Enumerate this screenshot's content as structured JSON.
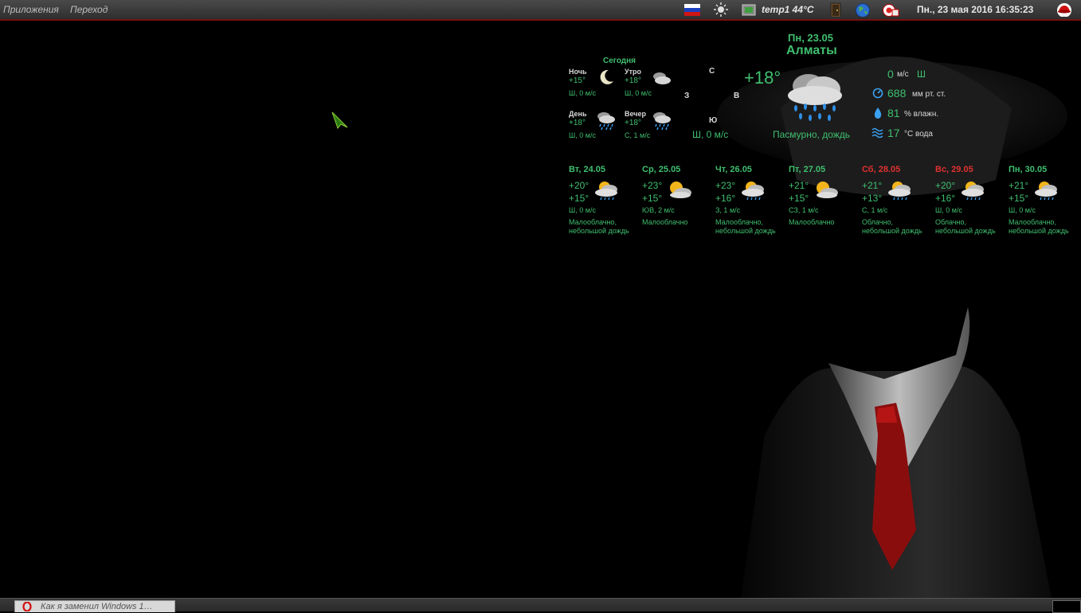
{
  "panel": {
    "menu_apps": "Приложения",
    "menu_go": "Переход",
    "sensor": "temp1 44°C",
    "datetime": "Пн., 23 мая 2016 16:35:23"
  },
  "current": {
    "date": "Пн, 23.05",
    "city": "Алматы",
    "temp": "+18°",
    "condition": "Пасмурно, дождь",
    "compass": {
      "n": "С",
      "w": "З",
      "e": "В",
      "s": "Ю"
    },
    "wind": "Ш, 0 м/с",
    "wind_speed": "0",
    "wind_unit": "м/с",
    "wind_dir": "Ш",
    "pressure": "688",
    "pressure_unit": "мм рт. ст.",
    "humidity": "81",
    "humidity_unit": "% влажн.",
    "water": "17",
    "water_unit": "°С вода"
  },
  "today": {
    "label": "Сегодня",
    "parts": [
      {
        "name": "Ночь",
        "temp": "+15°",
        "wind": "Ш, 0 м/с",
        "icon": "moon-icon"
      },
      {
        "name": "Утро",
        "temp": "+18°",
        "wind": "Ш, 0 м/с",
        "icon": "cloudy-icon"
      },
      {
        "name": "День",
        "temp": "+18°",
        "wind": "Ш, 0 м/с",
        "icon": "rain-icon"
      },
      {
        "name": "Вечер",
        "temp": "+18°",
        "wind": "С, 1 м/с",
        "icon": "rain-icon"
      }
    ]
  },
  "forecast": [
    {
      "day": "Вт, 24.05",
      "hi": "+20°",
      "lo": "+15°",
      "wind": "Ш, 0 м/с",
      "desc1": "Малооблачно,",
      "desc2": "небольшой дождь",
      "icon": "sun-rain-icon",
      "weekend": false
    },
    {
      "day": "Ср, 25.05",
      "hi": "+23°",
      "lo": "+15°",
      "wind": "ЮВ, 2 м/с",
      "desc1": "Малооблачно",
      "desc2": "",
      "icon": "sun-cloud-icon",
      "weekend": false
    },
    {
      "day": "Чт, 26.05",
      "hi": "+23°",
      "lo": "+16°",
      "wind": "З, 1 м/с",
      "desc1": "Малооблачно,",
      "desc2": "небольшой дождь",
      "icon": "sun-rain-icon",
      "weekend": false
    },
    {
      "day": "Пт, 27.05",
      "hi": "+21°",
      "lo": "+15°",
      "wind": "СЗ, 1 м/с",
      "desc1": "Малооблачно",
      "desc2": "",
      "icon": "sun-cloud-icon",
      "weekend": false
    },
    {
      "day": "Сб, 28.05",
      "hi": "+21°",
      "lo": "+13°",
      "wind": "С, 1 м/с",
      "desc1": "Облачно,",
      "desc2": "небольшой дождь",
      "icon": "sun-rain-icon",
      "weekend": true
    },
    {
      "day": "Вс, 29.05",
      "hi": "+20°",
      "lo": "+16°",
      "wind": "Ш, 0 м/с",
      "desc1": "Облачно,",
      "desc2": "небольшой дождь",
      "icon": "sun-rain-icon",
      "weekend": true
    },
    {
      "day": "Пн, 30.05",
      "hi": "+21°",
      "lo": "+15°",
      "wind": "Ш, 0 м/с",
      "desc1": "Малооблачно,",
      "desc2": "небольшой дождь",
      "icon": "sun-rain-icon",
      "weekend": false
    }
  ],
  "taskbar": {
    "window_title": "Как я заменил Windows 1…"
  },
  "colors": {
    "accent": "#3fbf6f",
    "weekend": "#e03030",
    "panel_border": "#7a1010"
  }
}
